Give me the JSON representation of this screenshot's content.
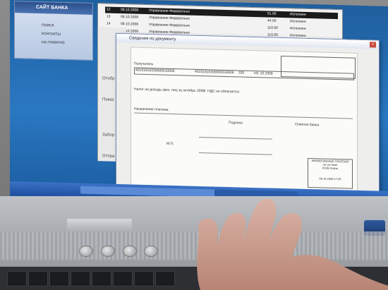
{
  "bank_panel": {
    "title": "САЙТ БАНКА",
    "links": [
      "ПОИСК",
      "КОНТАКТЫ",
      "НА ГЛАВНУЮ"
    ]
  },
  "list_window": {
    "rows": [
      {
        "num": "12",
        "date": "08.10.2008",
        "name": "Управление Федерально",
        "amount": "91.00",
        "status": "Исполнен",
        "selected": true
      },
      {
        "num": "13",
        "date": "08.10.2008",
        "name": "Управление Федерально",
        "amount": "44.00",
        "status": "Исполнен",
        "selected": false
      },
      {
        "num": "14",
        "date": "08.10.2008",
        "name": "Управление Федерально",
        "amount": "110.00",
        "status": "Исполнен",
        "selected": false
      },
      {
        "num": "15",
        "date": "08.10.2008",
        "name": "Управление Федерально",
        "amount": "110.00",
        "status": "Исполнен",
        "selected": false
      }
    ]
  },
  "side_window": {
    "labels": [
      "Отобр",
      "Показ",
      "Забор",
      "Отпра"
    ]
  },
  "dialog": {
    "title": "Сведения по документу",
    "close": "×",
    "doc": {
      "recipient_label": "Получатель",
      "account": "40101810200000010006",
      "inn": "40101810200000010006",
      "code": "335",
      "period": "НС 10.2008",
      "purpose": "Налог на доходы физ. лиц за октябрь 2008г. НДС не облагается.",
      "payment_label": "Назначение платежа",
      "signatures_label": "Подписи",
      "bank_marks_label": "Отметки банка",
      "mp_label": "М.П.",
      "stamp": [
        "ИНКЛЮЧАЕМЫЕ ПЛАТЕЖИ",
        "по системе",
        "iFOB-Online",
        "",
        "08.10.2008 17:05"
      ]
    }
  },
  "taskbar": {
    "tasks": [
      "",
      "",
      ""
    ]
  }
}
